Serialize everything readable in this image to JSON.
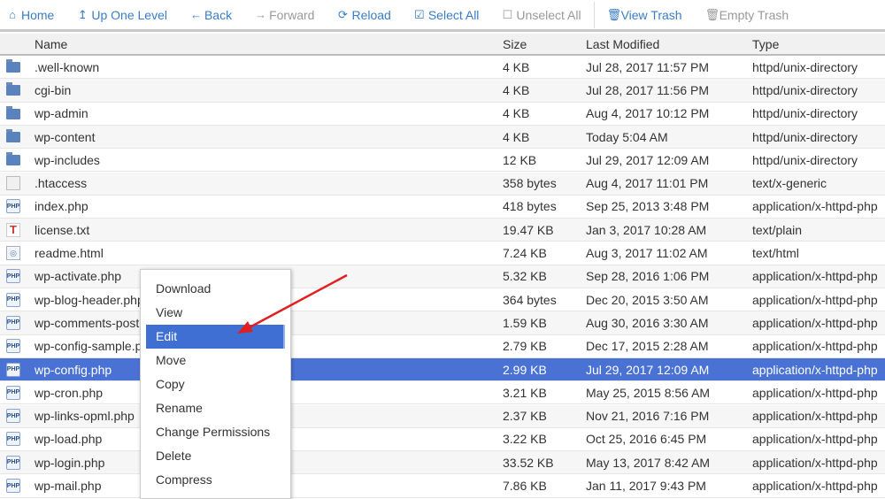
{
  "toolbar": [
    {
      "label": "Home",
      "icon": "home-icon",
      "glyph": "⌂",
      "disabled": false
    },
    {
      "label": "Up One Level",
      "icon": "level-up-icon",
      "glyph": "↥",
      "disabled": false
    },
    {
      "label": "Back",
      "icon": "arrow-left-icon",
      "glyph": "←",
      "disabled": false
    },
    {
      "label": "Forward",
      "icon": "arrow-right-icon",
      "glyph": "→",
      "disabled": true
    },
    {
      "label": "Reload",
      "icon": "reload-icon",
      "glyph": "⟳",
      "disabled": false
    },
    {
      "label": "Select All",
      "icon": "checkbox-checked-icon",
      "glyph": "☑",
      "disabled": false
    },
    {
      "label": "Unselect All",
      "icon": "checkbox-empty-icon",
      "glyph": "☐",
      "disabled": true
    },
    {
      "label": "View Trash",
      "icon": "trash-icon",
      "glyph": "🗑",
      "disabled": false
    },
    {
      "label": "Empty Trash",
      "icon": "trash-icon",
      "glyph": "🗑",
      "disabled": true
    }
  ],
  "columns": {
    "name": "Name",
    "size": "Size",
    "modified": "Last Modified",
    "type": "Type"
  },
  "files": [
    {
      "name": ".well-known",
      "size": "4 KB",
      "modified": "Jul 28, 2017 11:57 PM",
      "type": "httpd/unix-directory",
      "kind": "folder"
    },
    {
      "name": "cgi-bin",
      "size": "4 KB",
      "modified": "Jul 28, 2017 11:56 PM",
      "type": "httpd/unix-directory",
      "kind": "folder"
    },
    {
      "name": "wp-admin",
      "size": "4 KB",
      "modified": "Aug 4, 2017 10:12 PM",
      "type": "httpd/unix-directory",
      "kind": "folder"
    },
    {
      "name": "wp-content",
      "size": "4 KB",
      "modified": "Today 5:04 AM",
      "type": "httpd/unix-directory",
      "kind": "folder"
    },
    {
      "name": "wp-includes",
      "size": "12 KB",
      "modified": "Jul 29, 2017 12:09 AM",
      "type": "httpd/unix-directory",
      "kind": "folder"
    },
    {
      "name": ".htaccess",
      "size": "358 bytes",
      "modified": "Aug 4, 2017 11:01 PM",
      "type": "text/x-generic",
      "kind": "gen"
    },
    {
      "name": "index.php",
      "size": "418 bytes",
      "modified": "Sep 25, 2013 3:48 PM",
      "type": "application/x-httpd-php",
      "kind": "php"
    },
    {
      "name": "license.txt",
      "size": "19.47 KB",
      "modified": "Jan 3, 2017 10:28 AM",
      "type": "text/plain",
      "kind": "txt"
    },
    {
      "name": "readme.html",
      "size": "7.24 KB",
      "modified": "Aug 3, 2017 11:02 AM",
      "type": "text/html",
      "kind": "htm"
    },
    {
      "name": "wp-activate.php",
      "size": "5.32 KB",
      "modified": "Sep 28, 2016 1:06 PM",
      "type": "application/x-httpd-php",
      "kind": "php"
    },
    {
      "name": "wp-blog-header.php",
      "size": "364 bytes",
      "modified": "Dec 20, 2015 3:50 AM",
      "type": "application/x-httpd-php",
      "kind": "php"
    },
    {
      "name": "wp-comments-post.php",
      "size": "1.59 KB",
      "modified": "Aug 30, 2016 3:30 AM",
      "type": "application/x-httpd-php",
      "kind": "php"
    },
    {
      "name": "wp-config-sample.php",
      "size": "2.79 KB",
      "modified": "Dec 17, 2015 2:28 AM",
      "type": "application/x-httpd-php",
      "kind": "php"
    },
    {
      "name": "wp-config.php",
      "size": "2.99 KB",
      "modified": "Jul 29, 2017 12:09 AM",
      "type": "application/x-httpd-php",
      "kind": "php",
      "selected": true
    },
    {
      "name": "wp-cron.php",
      "size": "3.21 KB",
      "modified": "May 25, 2015 8:56 AM",
      "type": "application/x-httpd-php",
      "kind": "php"
    },
    {
      "name": "wp-links-opml.php",
      "size": "2.37 KB",
      "modified": "Nov 21, 2016 7:16 PM",
      "type": "application/x-httpd-php",
      "kind": "php"
    },
    {
      "name": "wp-load.php",
      "size": "3.22 KB",
      "modified": "Oct 25, 2016 6:45 PM",
      "type": "application/x-httpd-php",
      "kind": "php"
    },
    {
      "name": "wp-login.php",
      "size": "33.52 KB",
      "modified": "May 13, 2017 8:42 AM",
      "type": "application/x-httpd-php",
      "kind": "php"
    },
    {
      "name": "wp-mail.php",
      "size": "7.86 KB",
      "modified": "Jan 11, 2017 9:43 PM",
      "type": "application/x-httpd-php",
      "kind": "php"
    }
  ],
  "context_menu": [
    "Download",
    "View",
    "Edit",
    "Move",
    "Copy",
    "Rename",
    "Change Permissions",
    "Delete",
    "Compress"
  ],
  "highlighted_menu_item": "Edit",
  "php_icon_text": "PHP",
  "txt_icon_text": "T",
  "colors": {
    "accent": "#3a7cc7",
    "selected": "#4a72d4",
    "arrow": "#e02020"
  }
}
